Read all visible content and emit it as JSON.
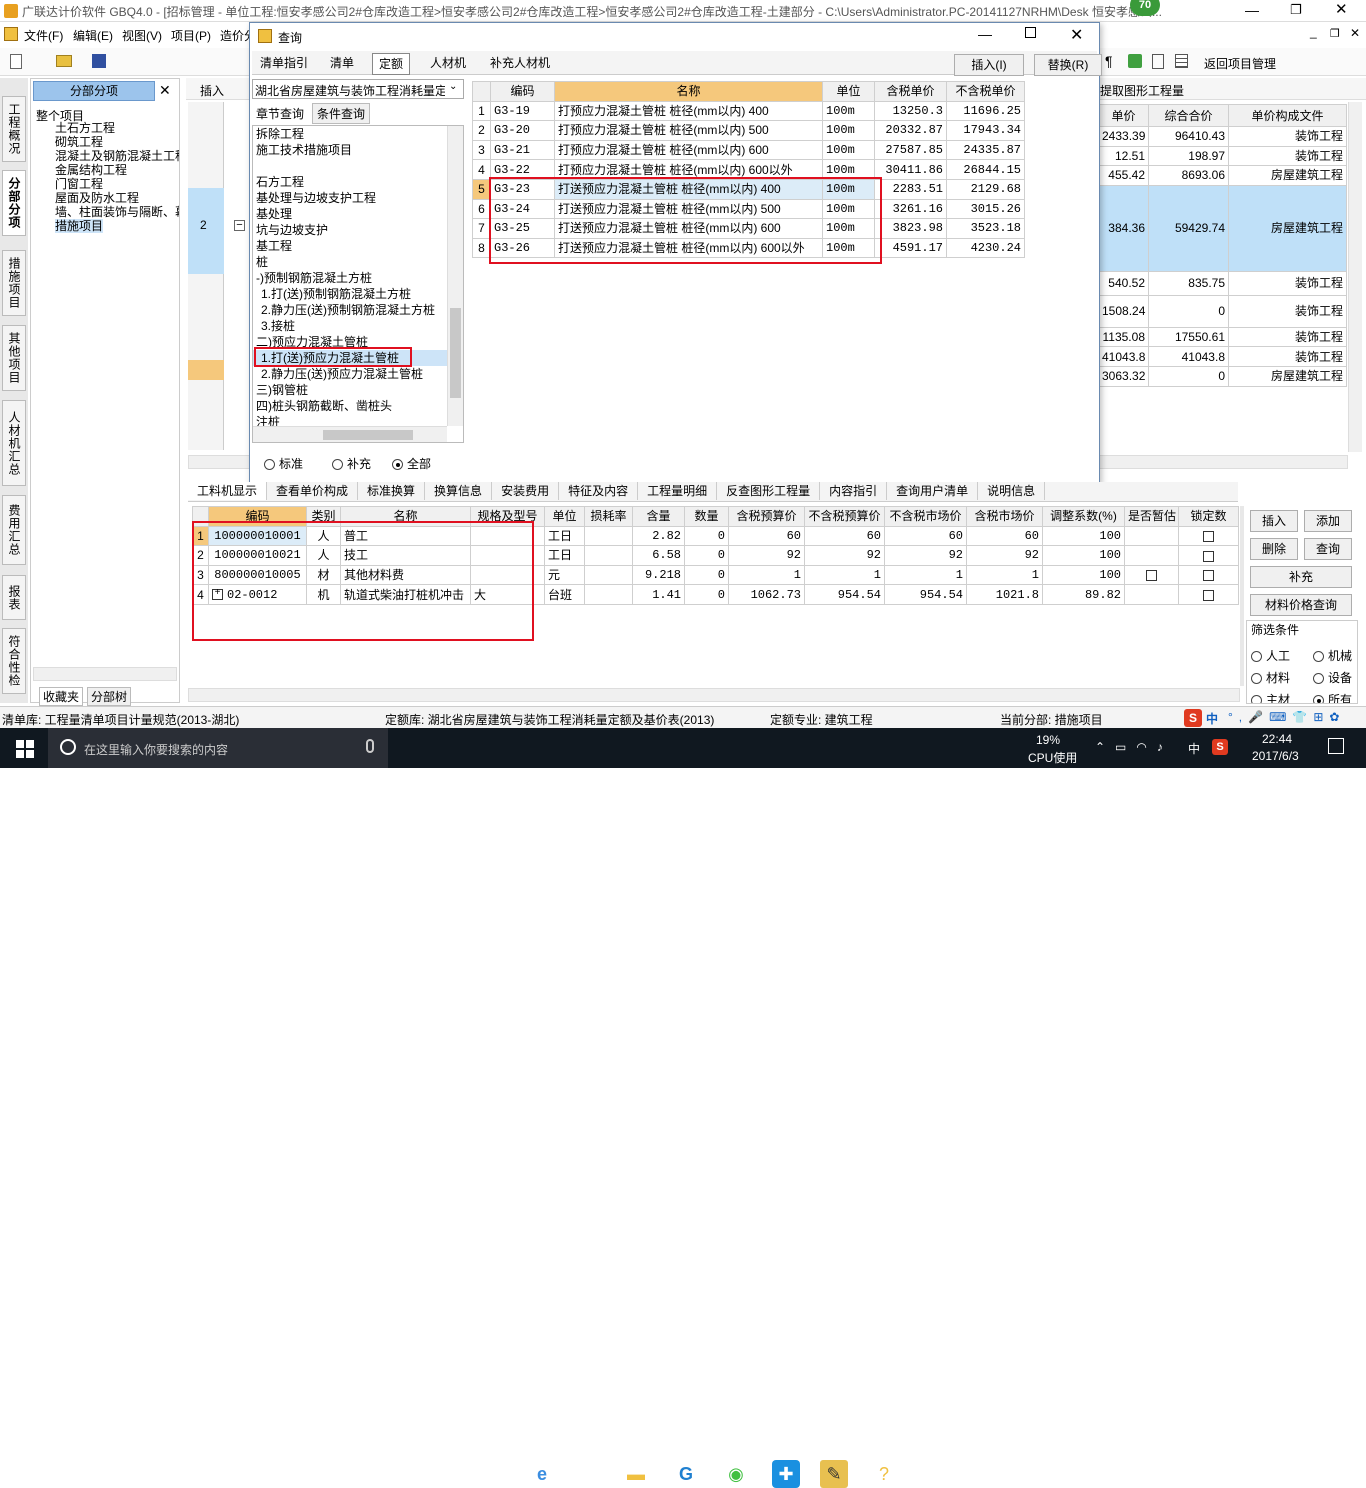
{
  "app": {
    "title": "广联达计价软件 GBQ4.0 - [招标管理 - 单位工程:恒安孝感公司2#仓库改造工程>恒安孝感公司2#仓库改造工程>恒安孝感公司2#仓库改造工程-土建部分 - C:\\Users\\Administrator.PC-20141127NRHM\\Desk 恒安孝感公...",
    "badge": "70"
  },
  "menu": [
    "文件(F)",
    "编辑(E)",
    "视图(V)",
    "项目(P)",
    "造价分"
  ],
  "toolbar": {
    "return_label": "返回项目管理",
    "pilcrow": "¶"
  },
  "left_panel": {
    "header": "分部分项",
    "close": "✕",
    "tree_root": "整个项目",
    "tree_items": [
      "土石方工程",
      "砌筑工程",
      "混凝土及钢筋混凝土工程",
      "金属结构工程",
      "门窗工程",
      "屋面及防水工程",
      "墙、柱面装饰与隔断、幕",
      "措施项目"
    ],
    "bottom_tabs": [
      "收藏夹",
      "分部树"
    ]
  },
  "side_tabs": [
    "工程概况",
    "分部分项",
    "措施项目",
    "其他项目",
    "人材机汇总",
    "费用汇总",
    "报表",
    "符合性检查"
  ],
  "insert_btn": "插入",
  "right_grid": {
    "link": "提取图形工程量",
    "headers": [
      "单价",
      "综合合价",
      "单价构成文件"
    ],
    "rows": [
      [
        "2433.39",
        "96410.43",
        "装饰工程"
      ],
      [
        "12.51",
        "198.97",
        "装饰工程"
      ],
      [
        "455.42",
        "8693.06",
        "房屋建筑工程"
      ],
      [
        "384.36",
        "59429.74",
        "房屋建筑工程"
      ],
      [
        "540.52",
        "835.75",
        "装饰工程"
      ],
      [
        "1508.24",
        "0",
        "装饰工程"
      ],
      [
        "1135.08",
        "17550.61",
        "装饰工程"
      ],
      [
        "41043.8",
        "41043.8",
        "装饰工程"
      ],
      [
        "3063.32",
        "0",
        "房屋建筑工程"
      ]
    ],
    "row_label": "2"
  },
  "dialog": {
    "title": "查询",
    "tabs": [
      "清单指引",
      "清单",
      "定额",
      "人材机",
      "补充人材机"
    ],
    "active_tab": "定额",
    "btn_insert": "插入(I)",
    "btn_replace": "替换(R)",
    "lib_select": "湖北省房屋建筑与装饰工程消耗量定",
    "subtabs": [
      "章节查询",
      "条件查询"
    ],
    "tree": [
      "拆除工程",
      "施工技术措施项目",
      "",
      "石方工程",
      "基处理与边坡支护工程",
      "基处理",
      "坑与边坡支护",
      "基工程",
      "桩",
      "-)预制钢筋混凝土方桩",
      "1.打(送)预制钢筋混凝土方桩",
      "2.静力压(送)预制钢筋混凝土方桩",
      "3.接桩",
      "二)预应力混凝土管桩",
      "1.打(送)预应力混凝土管桩",
      "2.静力压(送)预应力混凝土管桩",
      "三)钢管桩",
      "四)桩头钢筋截断、凿桩头",
      "注桩"
    ],
    "radios": [
      "标准",
      "补充",
      "全部"
    ],
    "grid_headers": [
      "编码",
      "名称",
      "单位",
      "含税单价",
      "不含税单价"
    ],
    "rows": [
      [
        "1",
        "G3-19",
        "打预应力混凝土管桩 桩径(mm以内) 400",
        "100m",
        "13250.3",
        "11696.25"
      ],
      [
        "2",
        "G3-20",
        "打预应力混凝土管桩 桩径(mm以内) 500",
        "100m",
        "20332.87",
        "17943.34"
      ],
      [
        "3",
        "G3-21",
        "打预应力混凝土管桩 桩径(mm以内) 600",
        "100m",
        "27587.85",
        "24335.87"
      ],
      [
        "4",
        "G3-22",
        "打预应力混凝土管桩 桩径(mm以内) 600以外",
        "100m",
        "30411.86",
        "26844.15"
      ],
      [
        "5",
        "G3-23",
        "打送预应力混凝土管桩 桩径(mm以内) 400",
        "100m",
        "2283.51",
        "2129.68"
      ],
      [
        "6",
        "G3-24",
        "打送预应力混凝土管桩 桩径(mm以内) 500",
        "100m",
        "3261.16",
        "3015.26"
      ],
      [
        "7",
        "G3-25",
        "打送预应力混凝土管桩 桩径(mm以内) 600",
        "100m",
        "3823.98",
        "3523.18"
      ],
      [
        "8",
        "G3-26",
        "打送预应力混凝土管桩 桩径(mm以内) 600以外",
        "100m",
        "4591.17",
        "4230.24"
      ]
    ]
  },
  "bottom": {
    "tabs": [
      "工料机显示",
      "查看单价构成",
      "标准换算",
      "换算信息",
      "安装费用",
      "特征及内容",
      "工程量明细",
      "反查图形工程量",
      "内容指引",
      "查询用户清单",
      "说明信息"
    ],
    "headers": [
      "编码",
      "类别",
      "名称",
      "规格及型号",
      "单位",
      "损耗率",
      "含量",
      "数量",
      "含税预算价",
      "不含税预算价",
      "不含税市场价",
      "含税市场价",
      "调整系数(%)",
      "是否暂估",
      "锁定数"
    ],
    "rows": [
      [
        "1",
        "100000010001",
        "人",
        "普工",
        "",
        "工日",
        "",
        "2.82",
        "0",
        "60",
        "60",
        "60",
        "60",
        "100"
      ],
      [
        "2",
        "100000010021",
        "人",
        "技工",
        "",
        "工日",
        "",
        "6.58",
        "0",
        "92",
        "92",
        "92",
        "92",
        "100"
      ],
      [
        "3",
        "800000010005",
        "材",
        "其他材料费",
        "",
        "元",
        "",
        "9.218",
        "0",
        "1",
        "1",
        "1",
        "1",
        "100"
      ],
      [
        "4",
        "02-0012",
        "机",
        "轨道式柴油打桩机冲击",
        "大",
        "台班",
        "",
        "1.41",
        "0",
        "1062.73",
        "954.54",
        "954.54",
        "1021.8",
        "89.82"
      ]
    ],
    "buttons": [
      "插入",
      "添加",
      "删除",
      "查询",
      "补充",
      "材料价格查询"
    ],
    "filter_title": "筛选条件",
    "filters": [
      "人工",
      "机械",
      "材料",
      "设备",
      "主材",
      "所有"
    ]
  },
  "status": {
    "qd_lib": "清单库: 工程量清单项目计量规范(2013-湖北)",
    "de_lib": "定额库: 湖北省房屋建筑与装饰工程消耗量定额及基价表(2013)",
    "de_major": "定额专业: 建筑工程",
    "cur": "当前分部: 措施项目"
  },
  "taskbar": {
    "search": "在这里输入你要搜索的内容",
    "cpu_pct": "19%",
    "cpu_label": "CPU使用",
    "ime": "中",
    "time": "22:44",
    "date": "2017/6/3"
  }
}
